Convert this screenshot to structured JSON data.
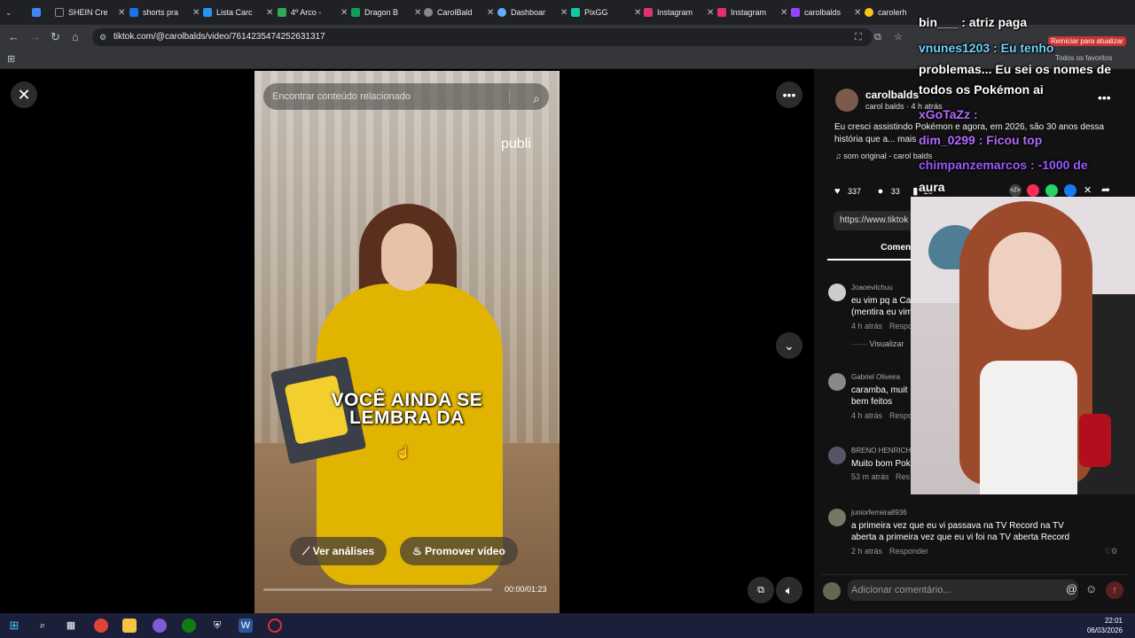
{
  "browser": {
    "tabs": [
      {
        "label": "SHEIN Cre",
        "color": "#222222"
      },
      {
        "label": "shorts pra",
        "color": "#1a73e8"
      },
      {
        "label": "Lista Carc",
        "color": "#2196f3"
      },
      {
        "label": "4º Arco -",
        "color": "#34a853"
      },
      {
        "label": "Dragon B",
        "color": "#0f9d58"
      },
      {
        "label": "CarolBald",
        "color": "#888888"
      },
      {
        "label": "Dashboar",
        "color": "#66aaff"
      },
      {
        "label": "PixGG",
        "color": "#13c7a0"
      },
      {
        "label": "Instagram",
        "color": "#e1306c"
      },
      {
        "label": "Instagram",
        "color": "#e1306c"
      },
      {
        "label": "carolbalds",
        "color": "#9146ff"
      },
      {
        "label": "carolerh",
        "color": "#f5c518"
      }
    ],
    "url": "tiktok.com/@carolbalds/video/7614235474252631317",
    "restart_label": "Reiniciar para atualizar",
    "favorites_label": "Todos os favoritos"
  },
  "video": {
    "search_placeholder": "Encontrar conteúdo relacionado",
    "publi": "publi",
    "caption_line1": "VOCÊ AINDA SE",
    "caption_line2": "LEMBRA DA",
    "btn_analytics": "Ver análises",
    "btn_promote": "Promover vídeo",
    "time": "00:00/01:23",
    "progress": 0.0
  },
  "post": {
    "author": "carolbalds",
    "author_sub": "carol balds · 4 h atrás",
    "description": "Eu cresci assistindo Pokémon e agora, em 2026, são 30 anos dessa história que a... mais",
    "sound": "som original - carol balds",
    "likes": "337",
    "comments": "33",
    "saves": "20",
    "link": "https://www.tiktok",
    "tab_comments": "Comentário"
  },
  "comments": [
    {
      "user": "Joaoevilchuu",
      "text_l1": "eu vim pq a Ca",
      "text_l2": "(mentira eu vim",
      "meta": "4 h atrás",
      "reply": "Respon"
    },
    {
      "user": "Gabriel Oliveira",
      "text_l1": "caramba, muit",
      "text_l2": "bem feitos",
      "meta": "4 h atrás",
      "reply": "Respo"
    },
    {
      "user": "BRENO HENRICH",
      "text_l1": "Muito bom Pok",
      "text_l2": "",
      "meta": "53 m atrás",
      "reply": "Res"
    },
    {
      "user": "juniorferreira8936",
      "text_l1": "a primeira vez que eu vi passava na TV Record na TV",
      "text_l2": "aberta a primeira vez que eu vi foi na TV aberta Record",
      "meta": "2 h atrás",
      "reply": "Responder",
      "likes": "0"
    }
  ],
  "view_replies": "Visualizar",
  "add_comment_placeholder": "Adicionar comentário...",
  "chat": [
    {
      "text": "bin___ : atriz paga",
      "color": "#ffffff"
    },
    {
      "text": "vnunes1203 : Eu tenho",
      "color": "#6fd3ff"
    },
    {
      "text": "problemas... Eu sei os nomes de",
      "color": "#ffffff"
    },
    {
      "text": "todos os Pokémon ai",
      "color": "#ffffff"
    },
    {
      "text": "xGoTaZz :",
      "color": "#b36bff"
    },
    {
      "text": "dim_0299 : Ficou top",
      "color": "#b36bff"
    },
    {
      "text": "chimpanzemarcos : -1000 de",
      "color": "#9b59ff"
    },
    {
      "text": "aura",
      "color": "#ffffff"
    }
  ],
  "taskbar": {
    "time": "22:01",
    "date": "06/03/2026"
  }
}
